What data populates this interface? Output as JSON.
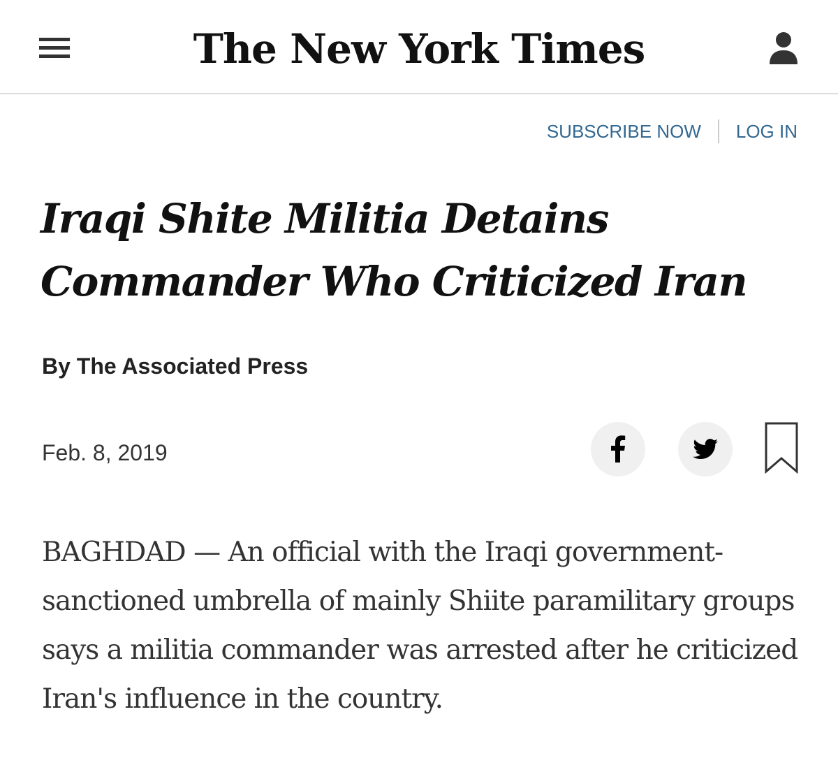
{
  "header": {
    "masthead": "The New York Times",
    "menu_icon": "hamburger-menu-icon",
    "account_icon": "user-account-icon"
  },
  "nav": {
    "subscribe": "SUBSCRIBE NOW",
    "login": "LOG IN"
  },
  "article": {
    "headline": "Iraqi Shite Militia Detains Commander Who Criticized Iran",
    "byline": "By The Associated Press",
    "date": "Feb. 8, 2019",
    "body": "BAGHDAD — An official with the Iraqi government-sanctioned umbrella of mainly Shiite paramilitary groups says a militia commander was arrested after he criticized Iran's influence in the country."
  },
  "share": {
    "facebook_icon": "facebook-icon",
    "twitter_icon": "twitter-icon",
    "bookmark_icon": "bookmark-icon"
  },
  "colors": {
    "link": "#326891",
    "text": "#121212",
    "body_text": "#333333",
    "button_bg": "#f0f0f0",
    "divider": "#dcdcdc"
  }
}
